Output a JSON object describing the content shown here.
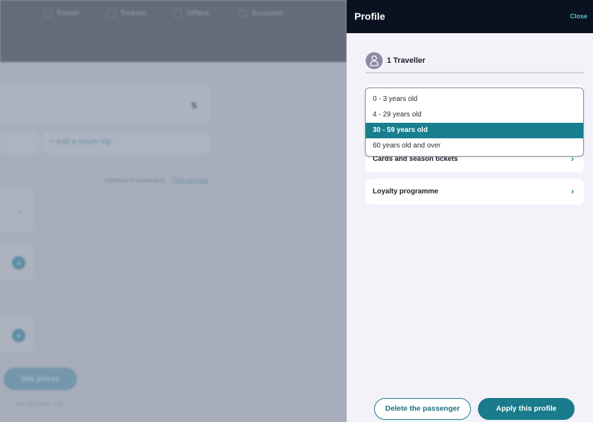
{
  "background_page": {
    "nav": [
      {
        "label": "Travel",
        "icon": "route-icon"
      },
      {
        "label": "Tickets",
        "icon": "ticket-icon"
      },
      {
        "label": "Offers",
        "icon": "offers-icon"
      },
      {
        "label": "Account",
        "icon": "user-icon"
      }
    ],
    "swap_icon": "⇅",
    "add_return_trip": "+ Add a return trip",
    "max_passengers": "maximum 9 passengers.",
    "find_out_more": "Find out more",
    "see_prices": "See prices",
    "see_itineraries": "See itineraries only"
  },
  "panel": {
    "title": "Profile",
    "close": "Close",
    "traveller_label": "1 Traveller",
    "age_dropdown": {
      "options": [
        "0 - 3 years old",
        "4 - 29 years old",
        "30 - 59 years old",
        "60 years old and over"
      ],
      "selected": "30 - 59 years old"
    },
    "rows": [
      {
        "label": "Cards and season tickets",
        "chevron": "›"
      },
      {
        "label": "Loyalty programme",
        "chevron": "›"
      }
    ],
    "delete_button": "Delete the passenger",
    "apply_button": "Apply this profile"
  },
  "colors": {
    "accent": "#177f8f",
    "header_dark": "#0a111f",
    "close_link": "#5cc3d0",
    "overlay": "#a7adba"
  }
}
